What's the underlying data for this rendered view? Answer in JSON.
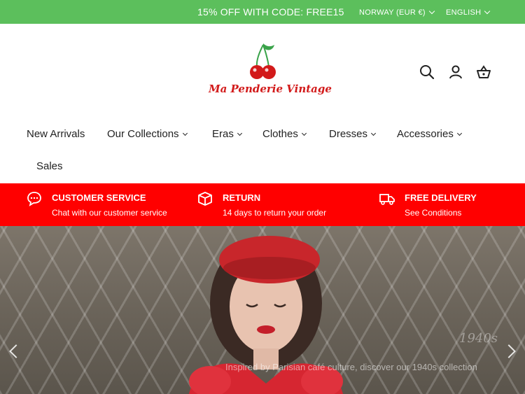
{
  "topbar": {
    "promo": "15% OFF WITH CODE: FREE15",
    "currency": "NORWAY (EUR €)",
    "language": "ENGLISH"
  },
  "header": {
    "logo_text": "Ma Penderie Vintage",
    "icons": [
      "search-icon",
      "account-icon",
      "cart-icon"
    ]
  },
  "nav": {
    "items": [
      {
        "label": "New Arrivals",
        "dropdown": false
      },
      {
        "label": "Our Collections",
        "dropdown": true
      },
      {
        "label": "Eras",
        "dropdown": true
      },
      {
        "label": "Clothes",
        "dropdown": true
      },
      {
        "label": "Dresses",
        "dropdown": true
      },
      {
        "label": "Accessories",
        "dropdown": true
      },
      {
        "label": "Sales",
        "dropdown": false
      }
    ]
  },
  "services": [
    {
      "icon": "chat-icon",
      "title": "CUSTOMER SERVICE",
      "subtitle": "Chat with our customer service"
    },
    {
      "icon": "box-icon",
      "title": "RETURN",
      "subtitle": "14 days to return your order"
    },
    {
      "icon": "truck-icon",
      "title": "FREE DELIVERY",
      "subtitle": "See Conditions"
    }
  ],
  "hero": {
    "caption": "Inspired by Parisian café culture, discover our 1940s collection",
    "year": "1940s"
  },
  "colors": {
    "topbar": "#5cbf5c",
    "service_bar": "#ff0000",
    "brand_red": "#d21a1a"
  }
}
